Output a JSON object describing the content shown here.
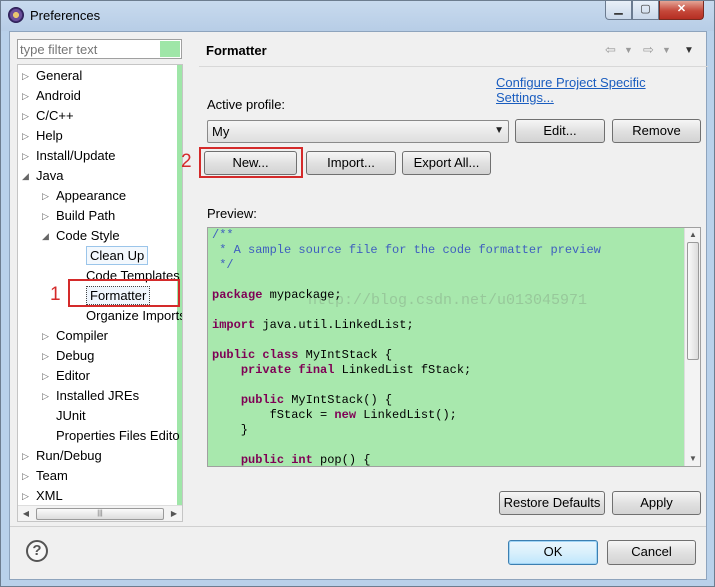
{
  "window": {
    "title": "Preferences"
  },
  "filter": {
    "placeholder": "type filter text"
  },
  "tree": [
    {
      "label": "General",
      "twisty": "▷",
      "indent": 0
    },
    {
      "label": "Android",
      "twisty": "▷",
      "indent": 0
    },
    {
      "label": "C/C++",
      "twisty": "▷",
      "indent": 0
    },
    {
      "label": "Help",
      "twisty": "▷",
      "indent": 0
    },
    {
      "label": "Install/Update",
      "twisty": "▷",
      "indent": 0
    },
    {
      "label": "Java",
      "twisty": "◢",
      "indent": 0
    },
    {
      "label": "Appearance",
      "twisty": "▷",
      "indent": 1
    },
    {
      "label": "Build Path",
      "twisty": "▷",
      "indent": 1
    },
    {
      "label": "Code Style",
      "twisty": "◢",
      "indent": 1
    },
    {
      "label": "Clean Up",
      "twisty": "",
      "indent": 2
    },
    {
      "label": "Code Templates",
      "twisty": "",
      "indent": 2
    },
    {
      "label": "Formatter",
      "twisty": "",
      "indent": 2
    },
    {
      "label": "Organize Imports",
      "twisty": "",
      "indent": 2
    },
    {
      "label": "Compiler",
      "twisty": "▷",
      "indent": 1
    },
    {
      "label": "Debug",
      "twisty": "▷",
      "indent": 1
    },
    {
      "label": "Editor",
      "twisty": "▷",
      "indent": 1
    },
    {
      "label": "Installed JREs",
      "twisty": "▷",
      "indent": 1
    },
    {
      "label": "JUnit",
      "twisty": "",
      "indent": 1
    },
    {
      "label": "Properties Files Edito",
      "twisty": "",
      "indent": 1
    },
    {
      "label": "Run/Debug",
      "twisty": "▷",
      "indent": 0
    },
    {
      "label": "Team",
      "twisty": "▷",
      "indent": 0
    },
    {
      "label": "XML",
      "twisty": "▷",
      "indent": 0
    }
  ],
  "annotations": {
    "marker_1": "1",
    "marker_2": "2"
  },
  "page": {
    "title": "Formatter",
    "configure_link": "Configure Project Specific Settings...",
    "active_profile_label": "Active profile:",
    "profile_value": "My",
    "edit_label": "Edit...",
    "remove_label": "Remove",
    "new_label": "New...",
    "import_label": "Import...",
    "export_label": "Export All...",
    "preview_label": "Preview:",
    "watermark": "http://blog.csdn.net/u013045971"
  },
  "preview_code": [
    [
      [
        "cm",
        "/**"
      ]
    ],
    [
      [
        "cm",
        " * A sample source file for the code formatter preview"
      ]
    ],
    [
      [
        "cm",
        " */"
      ]
    ],
    [],
    [
      [
        "kw",
        "package"
      ],
      [
        "",
        " mypackage;"
      ]
    ],
    [],
    [
      [
        "kw",
        "import"
      ],
      [
        "",
        " java.util.LinkedList;"
      ]
    ],
    [],
    [
      [
        "kw",
        "public class"
      ],
      [
        "",
        " MyIntStack {"
      ]
    ],
    [
      [
        "",
        "    "
      ],
      [
        "kw",
        "private final"
      ],
      [
        "",
        " LinkedList fStack;"
      ]
    ],
    [],
    [
      [
        "",
        "    "
      ],
      [
        "kw",
        "public"
      ],
      [
        "",
        " MyIntStack() {"
      ]
    ],
    [
      [
        "",
        "        fStack = "
      ],
      [
        "kw",
        "new"
      ],
      [
        "",
        " LinkedList();"
      ]
    ],
    [
      [
        "",
        "    }"
      ]
    ],
    [],
    [
      [
        "",
        "    "
      ],
      [
        "kw",
        "public int"
      ],
      [
        "",
        " pop() {"
      ]
    ]
  ],
  "footer": {
    "restore_label": "Restore Defaults",
    "apply_label": "Apply",
    "ok_label": "OK",
    "cancel_label": "Cancel"
  },
  "icons": [
    "app-icon",
    "minimize-icon",
    "maximize-icon",
    "close-icon",
    "back-icon",
    "forward-icon",
    "view-menu-icon",
    "help-icon"
  ],
  "colors": {
    "highlight_green": "#a8e8ad",
    "annotation_red": "#d42a2a",
    "link_blue": "#1a5dbf"
  }
}
